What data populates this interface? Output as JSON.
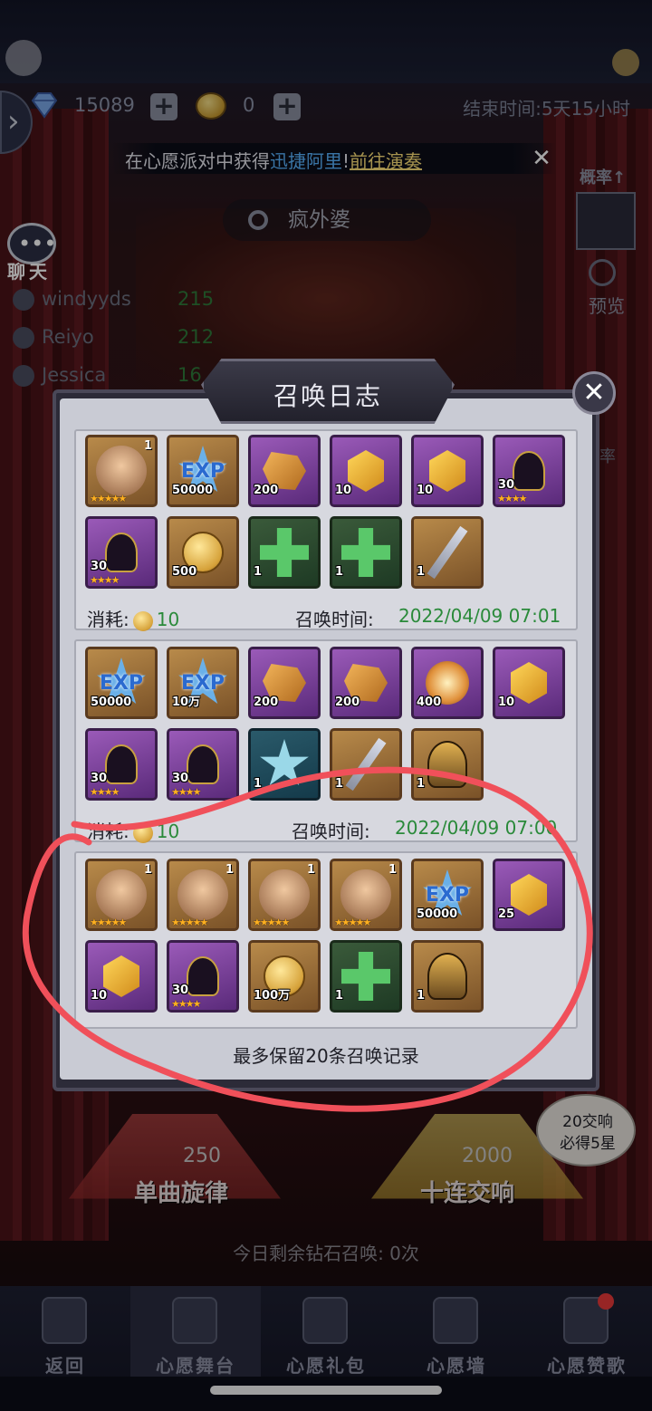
{
  "currency": {
    "diamonds": "15089",
    "coins": "0"
  },
  "event": {
    "end_time": "结束时间:5天15小时"
  },
  "notice": {
    "prefix": "在心愿派对中获得",
    "highlight": "迅捷阿里",
    "sep": "!",
    "link": "前往演奏"
  },
  "banner": {
    "name": "疯外婆"
  },
  "chat": {
    "label": "聊天"
  },
  "ranking": [
    {
      "name": "windyyds",
      "score": "215"
    },
    {
      "name": "Reiyo",
      "score": "212"
    },
    {
      "name": "Jessica",
      "score": "16"
    }
  ],
  "side": {
    "probability": "概率↑",
    "preview": "预览",
    "probability_short": "率"
  },
  "modal": {
    "title": "召唤日志",
    "cost_label": "消耗:",
    "time_label": "召唤时间:",
    "keep_note": "最多保留20条召唤记录",
    "records": [
      {
        "cost": "10",
        "time": "2022/04/09 07:01",
        "items": [
          {
            "kind": "hero",
            "icon": "demon-hero-portrait",
            "count": "1",
            "stars": 5
          },
          {
            "kind": "exp",
            "icon": "exp-star-icon",
            "amount": "50000"
          },
          {
            "kind": "ore",
            "icon": "orange-ore-icon",
            "amount": "200"
          },
          {
            "kind": "gem",
            "icon": "gold-gem-icon",
            "amount": "10"
          },
          {
            "kind": "gem",
            "icon": "gold-gem-icon",
            "amount": "10"
          },
          {
            "kind": "shard",
            "icon": "hooded-shard-icon",
            "amount": "30",
            "stars": 4
          },
          {
            "kind": "shard",
            "icon": "hooded-shard-icon",
            "amount": "30",
            "stars": 4
          },
          {
            "kind": "coin",
            "icon": "fist-coin-icon",
            "amount": "500"
          },
          {
            "kind": "cross",
            "icon": "green-cross-icon",
            "amount": "1"
          },
          {
            "kind": "cross",
            "icon": "green-cross-icon",
            "amount": "1"
          },
          {
            "kind": "sword",
            "icon": "sword-equip-icon",
            "amount": "1"
          }
        ]
      },
      {
        "cost": "10",
        "time": "2022/04/09 07:00",
        "items": [
          {
            "kind": "exp",
            "icon": "exp-star-icon",
            "amount": "50000"
          },
          {
            "kind": "exp",
            "icon": "exp-star-icon",
            "amount": "10万"
          },
          {
            "kind": "ore",
            "icon": "orange-ore-icon",
            "amount": "200"
          },
          {
            "kind": "ore",
            "icon": "orange-ore-icon",
            "amount": "200"
          },
          {
            "kind": "orb",
            "icon": "fire-orb-icon",
            "amount": "400"
          },
          {
            "kind": "gem",
            "icon": "gold-gem-icon",
            "amount": "10"
          },
          {
            "kind": "shard",
            "icon": "hooded-shard-icon",
            "amount": "30",
            "stars": 4
          },
          {
            "kind": "shard",
            "icon": "hooded-shard-icon",
            "amount": "30",
            "stars": 4
          },
          {
            "kind": "hexstar",
            "icon": "hex-star-icon",
            "amount": "1"
          },
          {
            "kind": "sword",
            "icon": "sword-equip-icon",
            "amount": "1"
          },
          {
            "kind": "helm",
            "icon": "spiked-helm-icon",
            "amount": "1"
          }
        ]
      },
      {
        "cost": "",
        "time": "",
        "items": [
          {
            "kind": "hero",
            "icon": "goblin-hero-portrait",
            "count": "1",
            "stars": 5
          },
          {
            "kind": "hero",
            "icon": "hat-hero-portrait",
            "count": "1",
            "stars": 5
          },
          {
            "kind": "hero",
            "icon": "witch-hero-portrait",
            "count": "1",
            "stars": 5
          },
          {
            "kind": "hero",
            "icon": "blonde-hero-portrait",
            "count": "1",
            "stars": 5
          },
          {
            "kind": "exp",
            "icon": "exp-star-icon",
            "amount": "50000"
          },
          {
            "kind": "gem",
            "icon": "gold-gem-icon",
            "amount": "25"
          },
          {
            "kind": "gem",
            "icon": "gold-gem-icon",
            "amount": "10"
          },
          {
            "kind": "shard",
            "icon": "hooded-shard-icon",
            "amount": "30",
            "stars": 4
          },
          {
            "kind": "coin",
            "icon": "gold-coin-icon",
            "amount": "100万"
          },
          {
            "kind": "cross",
            "icon": "green-cross-icon",
            "amount": "1"
          },
          {
            "kind": "helm",
            "icon": "spiked-helm-icon",
            "amount": "1"
          }
        ]
      }
    ]
  },
  "summon": {
    "single_label": "单曲旋律",
    "single_cost": "250",
    "ten_label": "十连交响",
    "ten_cost": "2000",
    "bonus_line1": "20交响",
    "bonus_line2": "必得5星",
    "daily_left": "今日剩余钻石召唤: 0次"
  },
  "nav": [
    {
      "label": "返回",
      "icon": "back-arrow-icon"
    },
    {
      "label": "心愿舞台",
      "icon": "music-stage-icon"
    },
    {
      "label": "心愿礼包",
      "icon": "gift-box-icon"
    },
    {
      "label": "心愿墙",
      "icon": "wall-book-icon"
    },
    {
      "label": "心愿赞歌",
      "icon": "record-disc-icon"
    }
  ],
  "colors": {
    "time_green": "#2a8a3a",
    "annotation_red": "#f0505a",
    "star_orange": "#ffb020"
  }
}
